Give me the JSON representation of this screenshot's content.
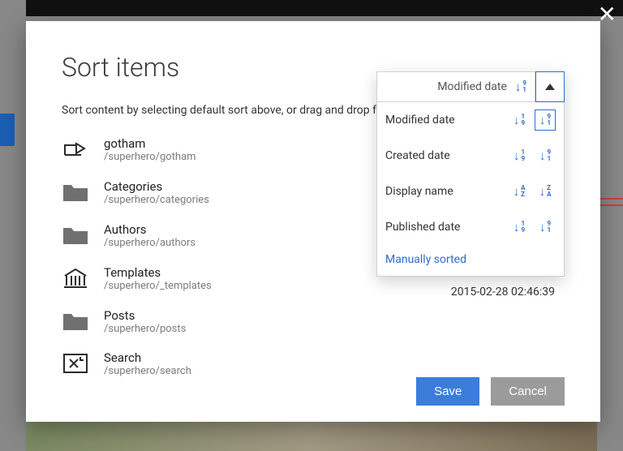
{
  "modal": {
    "title": "Sort items",
    "subtitle": "Sort content by selecting default sort above, or drag and drop for",
    "timestamp": "2015-02-28 02:46:39",
    "buttons": {
      "save": "Save",
      "cancel": "Cancel"
    }
  },
  "items": [
    {
      "name": "gotham",
      "path": "/superhero/gotham",
      "icon": "shortcut"
    },
    {
      "name": "Categories",
      "path": "/superhero/categories",
      "icon": "folder"
    },
    {
      "name": "Authors",
      "path": "/superhero/authors",
      "icon": "folder"
    },
    {
      "name": "Templates",
      "path": "/superhero/_templates",
      "icon": "temple"
    },
    {
      "name": "Posts",
      "path": "/superhero/posts",
      "icon": "folder"
    },
    {
      "name": "Search",
      "path": "/superhero/search",
      "icon": "search"
    }
  ],
  "sort": {
    "current": "Modified date",
    "current_glyph": {
      "top": "9",
      "bot": "1"
    },
    "manual_label": "Manually sorted",
    "options": [
      {
        "label": "Modified date",
        "asc": {
          "top": "1",
          "bot": "9"
        },
        "desc": {
          "top": "9",
          "bot": "1"
        },
        "selected": "desc"
      },
      {
        "label": "Created date",
        "asc": {
          "top": "1",
          "bot": "9"
        },
        "desc": {
          "top": "9",
          "bot": "1"
        }
      },
      {
        "label": "Display name",
        "asc": {
          "top": "A",
          "bot": "Z"
        },
        "desc": {
          "top": "Z",
          "bot": "A"
        }
      },
      {
        "label": "Published date",
        "asc": {
          "top": "1",
          "bot": "9"
        },
        "desc": {
          "top": "9",
          "bot": "1"
        }
      }
    ]
  }
}
